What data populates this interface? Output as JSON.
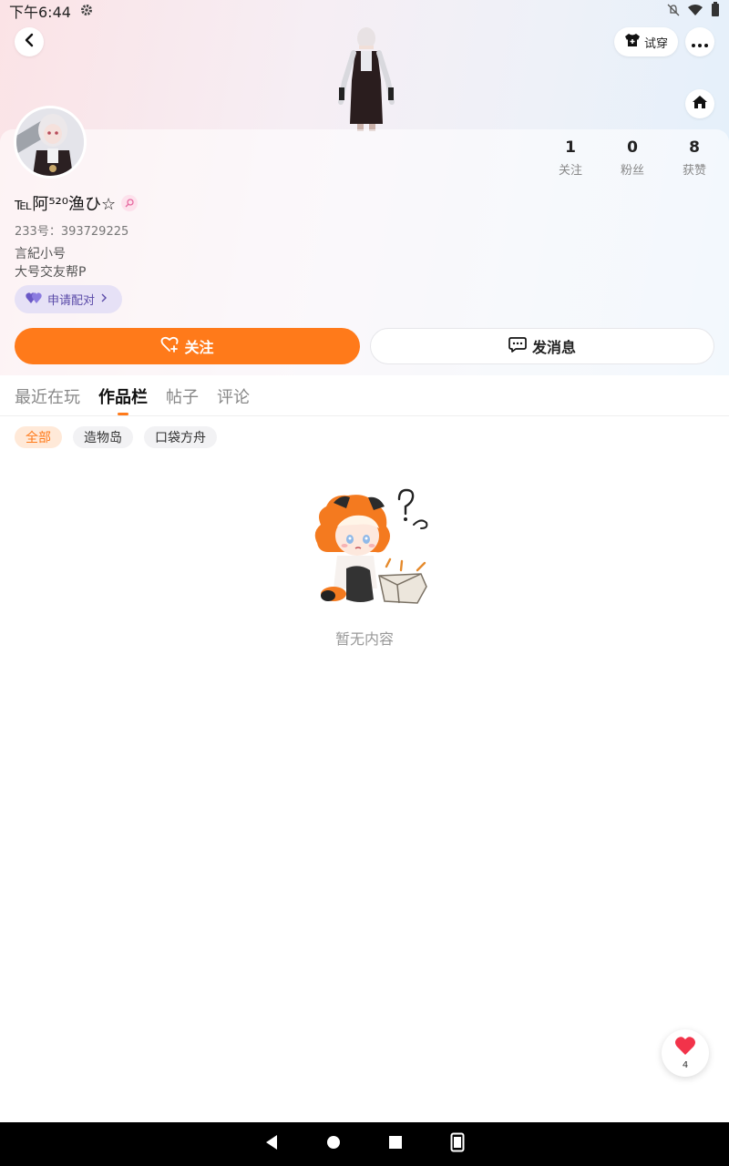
{
  "status_bar": {
    "time": "下午6:44"
  },
  "header": {
    "tryon_label": "试穿"
  },
  "profile": {
    "nickname": "℡阿⁵²⁰渔ひ☆",
    "uid": "233号：393729225",
    "bio_lines": [
      "言紀小号",
      "大号交友帮P"
    ],
    "pair_label": "申请配对",
    "stats": [
      {
        "num": "1",
        "label": "关注"
      },
      {
        "num": "0",
        "label": "粉丝"
      },
      {
        "num": "8",
        "label": "获赞"
      }
    ],
    "follow_label": "关注",
    "message_label": "发消息"
  },
  "tabs": [
    "最近在玩",
    "作品栏",
    "帖子",
    "评论"
  ],
  "active_tab": "作品栏",
  "filters": [
    "全部",
    "造物岛",
    "口袋方舟"
  ],
  "active_filter": "全部",
  "empty_text": "暂无内容",
  "like_count": "4",
  "colors": {
    "accent": "#ff7a1a",
    "pair_bg": "#e6e1f6",
    "pair_text": "#5a4aa8"
  },
  "icons": {
    "back": "chevron-left-icon",
    "more": "ellipsis-icon",
    "home": "home-icon",
    "tryon": "outfit-icon",
    "follow": "heart-plus-icon",
    "message": "chat-bubble-icon",
    "pair": "heart-pair-icon",
    "like": "heart-icon"
  }
}
